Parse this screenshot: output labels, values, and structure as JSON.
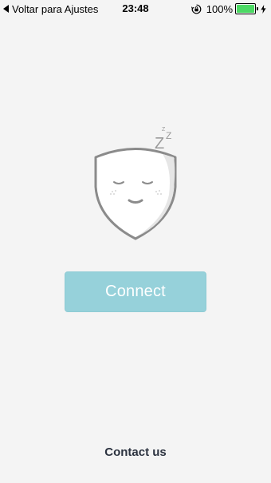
{
  "status_bar": {
    "back_label": "Voltar para Ajustes",
    "time": "23:48",
    "battery_percent": "100%",
    "battery_level": 1.0,
    "battery_color": "#4cd964",
    "icons": [
      "back-arrow-icon",
      "orientation-lock-icon",
      "battery-icon",
      "charging-bolt-icon"
    ]
  },
  "mascot": {
    "icon": "sleeping-shield-icon",
    "sleep_text": "Z z"
  },
  "main": {
    "connect_label": "Connect",
    "connect_color": "#96d1da"
  },
  "footer": {
    "contact_label": "Contact us",
    "contact_color": "#2c3340"
  }
}
